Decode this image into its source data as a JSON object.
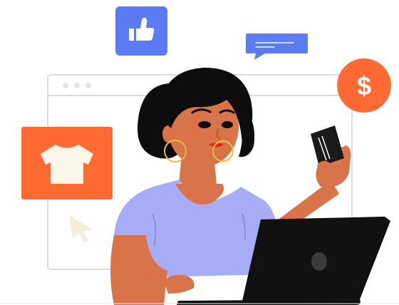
{
  "scene": {
    "description_free": true,
    "currency_symbol": "$",
    "colors": {
      "background": "#ffffff",
      "browser_border": "#dcdcdc",
      "browser_dots": "#dde6df",
      "like_badge": "#5b7bf2",
      "chat_bubble": "#5b7bf2",
      "price_badge": "#ff6a33",
      "product_card": "#ff6a33",
      "shirt": "#fbf6e8",
      "cursor": "#f2efd9",
      "hair": "#0d0d0d",
      "skin": "#d9734a",
      "skin_shadow": "#b95b38",
      "top": "#a7acf7",
      "laptop": "#111111",
      "laptop_logo": "#3a3a3a",
      "lips": "#e2231a",
      "earring": "#e8b84a",
      "card": "#1a1a1a"
    },
    "icons": {
      "like": "thumbs-up-icon",
      "chat": "chat-bubble-icon",
      "price": "dollar-sign-icon",
      "product": "tshirt-icon",
      "cursor": "cursor-arrow-icon",
      "card": "credit-card-icon",
      "laptop": "laptop-icon"
    }
  }
}
